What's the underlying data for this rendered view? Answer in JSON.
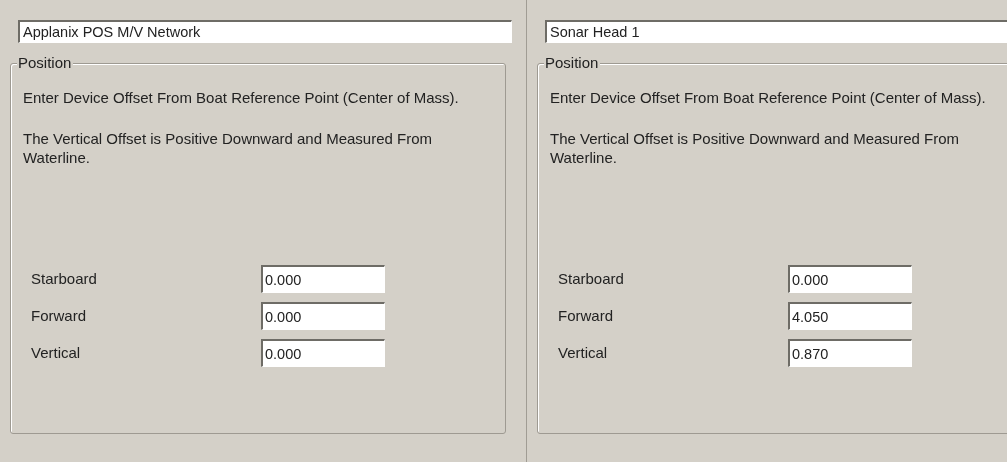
{
  "panels": [
    {
      "device_name": "Applanix POS M/V Network",
      "group_title": "Position",
      "paragraphs": [
        "Enter Device Offset From Boat Reference Point (Center of Mass).",
        "The Vertical Offset is Positive Downward and Measured From Waterline."
      ],
      "offsets": [
        {
          "label": "Starboard",
          "value": "0.000"
        },
        {
          "label": "Forward",
          "value": "0.000"
        },
        {
          "label": "Vertical",
          "value": "0.000"
        }
      ]
    },
    {
      "device_name": "Sonar Head 1",
      "group_title": "Position",
      "paragraphs": [
        "Enter Device Offset From Boat Reference Point (Center of Mass).",
        "The Vertical Offset is Positive Downward and Measured From Waterline."
      ],
      "offsets": [
        {
          "label": "Starboard",
          "value": "0.000"
        },
        {
          "label": "Forward",
          "value": "4.050"
        },
        {
          "label": "Vertical",
          "value": "0.870"
        }
      ]
    }
  ]
}
